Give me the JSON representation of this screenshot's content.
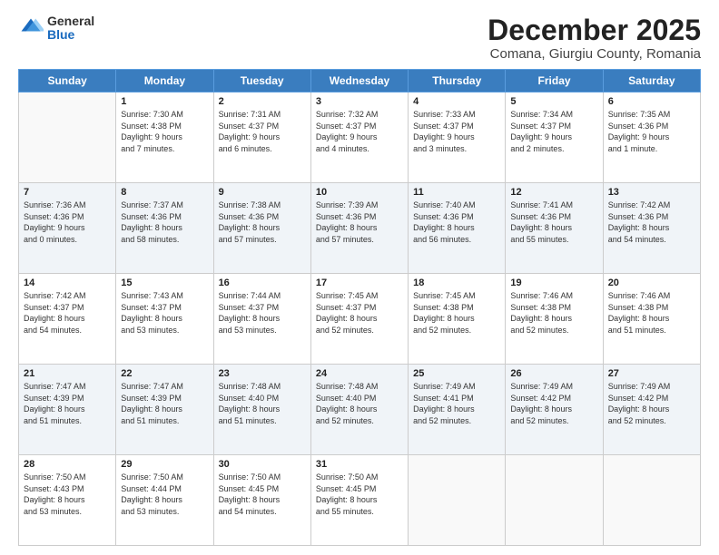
{
  "logo": {
    "general": "General",
    "blue": "Blue"
  },
  "title": {
    "month": "December 2025",
    "location": "Comana, Giurgiu County, Romania"
  },
  "days_header": [
    "Sunday",
    "Monday",
    "Tuesday",
    "Wednesday",
    "Thursday",
    "Friday",
    "Saturday"
  ],
  "weeks": [
    [
      {
        "day": "",
        "info": ""
      },
      {
        "day": "1",
        "info": "Sunrise: 7:30 AM\nSunset: 4:38 PM\nDaylight: 9 hours\nand 7 minutes."
      },
      {
        "day": "2",
        "info": "Sunrise: 7:31 AM\nSunset: 4:37 PM\nDaylight: 9 hours\nand 6 minutes."
      },
      {
        "day": "3",
        "info": "Sunrise: 7:32 AM\nSunset: 4:37 PM\nDaylight: 9 hours\nand 4 minutes."
      },
      {
        "day": "4",
        "info": "Sunrise: 7:33 AM\nSunset: 4:37 PM\nDaylight: 9 hours\nand 3 minutes."
      },
      {
        "day": "5",
        "info": "Sunrise: 7:34 AM\nSunset: 4:37 PM\nDaylight: 9 hours\nand 2 minutes."
      },
      {
        "day": "6",
        "info": "Sunrise: 7:35 AM\nSunset: 4:36 PM\nDaylight: 9 hours\nand 1 minute."
      }
    ],
    [
      {
        "day": "7",
        "info": "Sunrise: 7:36 AM\nSunset: 4:36 PM\nDaylight: 9 hours\nand 0 minutes."
      },
      {
        "day": "8",
        "info": "Sunrise: 7:37 AM\nSunset: 4:36 PM\nDaylight: 8 hours\nand 58 minutes."
      },
      {
        "day": "9",
        "info": "Sunrise: 7:38 AM\nSunset: 4:36 PM\nDaylight: 8 hours\nand 57 minutes."
      },
      {
        "day": "10",
        "info": "Sunrise: 7:39 AM\nSunset: 4:36 PM\nDaylight: 8 hours\nand 57 minutes."
      },
      {
        "day": "11",
        "info": "Sunrise: 7:40 AM\nSunset: 4:36 PM\nDaylight: 8 hours\nand 56 minutes."
      },
      {
        "day": "12",
        "info": "Sunrise: 7:41 AM\nSunset: 4:36 PM\nDaylight: 8 hours\nand 55 minutes."
      },
      {
        "day": "13",
        "info": "Sunrise: 7:42 AM\nSunset: 4:36 PM\nDaylight: 8 hours\nand 54 minutes."
      }
    ],
    [
      {
        "day": "14",
        "info": "Sunrise: 7:42 AM\nSunset: 4:37 PM\nDaylight: 8 hours\nand 54 minutes."
      },
      {
        "day": "15",
        "info": "Sunrise: 7:43 AM\nSunset: 4:37 PM\nDaylight: 8 hours\nand 53 minutes."
      },
      {
        "day": "16",
        "info": "Sunrise: 7:44 AM\nSunset: 4:37 PM\nDaylight: 8 hours\nand 53 minutes."
      },
      {
        "day": "17",
        "info": "Sunrise: 7:45 AM\nSunset: 4:37 PM\nDaylight: 8 hours\nand 52 minutes."
      },
      {
        "day": "18",
        "info": "Sunrise: 7:45 AM\nSunset: 4:38 PM\nDaylight: 8 hours\nand 52 minutes."
      },
      {
        "day": "19",
        "info": "Sunrise: 7:46 AM\nSunset: 4:38 PM\nDaylight: 8 hours\nand 52 minutes."
      },
      {
        "day": "20",
        "info": "Sunrise: 7:46 AM\nSunset: 4:38 PM\nDaylight: 8 hours\nand 51 minutes."
      }
    ],
    [
      {
        "day": "21",
        "info": "Sunrise: 7:47 AM\nSunset: 4:39 PM\nDaylight: 8 hours\nand 51 minutes."
      },
      {
        "day": "22",
        "info": "Sunrise: 7:47 AM\nSunset: 4:39 PM\nDaylight: 8 hours\nand 51 minutes."
      },
      {
        "day": "23",
        "info": "Sunrise: 7:48 AM\nSunset: 4:40 PM\nDaylight: 8 hours\nand 51 minutes."
      },
      {
        "day": "24",
        "info": "Sunrise: 7:48 AM\nSunset: 4:40 PM\nDaylight: 8 hours\nand 52 minutes."
      },
      {
        "day": "25",
        "info": "Sunrise: 7:49 AM\nSunset: 4:41 PM\nDaylight: 8 hours\nand 52 minutes."
      },
      {
        "day": "26",
        "info": "Sunrise: 7:49 AM\nSunset: 4:42 PM\nDaylight: 8 hours\nand 52 minutes."
      },
      {
        "day": "27",
        "info": "Sunrise: 7:49 AM\nSunset: 4:42 PM\nDaylight: 8 hours\nand 52 minutes."
      }
    ],
    [
      {
        "day": "28",
        "info": "Sunrise: 7:50 AM\nSunset: 4:43 PM\nDaylight: 8 hours\nand 53 minutes."
      },
      {
        "day": "29",
        "info": "Sunrise: 7:50 AM\nSunset: 4:44 PM\nDaylight: 8 hours\nand 53 minutes."
      },
      {
        "day": "30",
        "info": "Sunrise: 7:50 AM\nSunset: 4:45 PM\nDaylight: 8 hours\nand 54 minutes."
      },
      {
        "day": "31",
        "info": "Sunrise: 7:50 AM\nSunset: 4:45 PM\nDaylight: 8 hours\nand 55 minutes."
      },
      {
        "day": "",
        "info": ""
      },
      {
        "day": "",
        "info": ""
      },
      {
        "day": "",
        "info": ""
      }
    ]
  ]
}
